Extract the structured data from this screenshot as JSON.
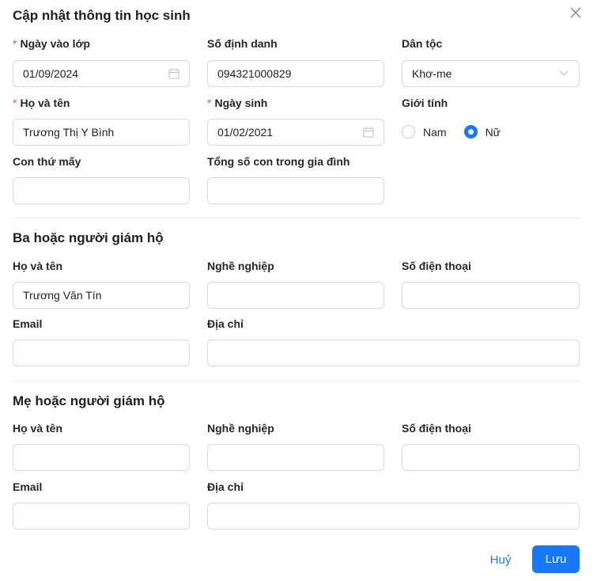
{
  "modal": {
    "title": "Cập nhật thông tin học sinh",
    "close_icon": "close-icon"
  },
  "student": {
    "enrollment_date": {
      "label": "Ngày vào lớp",
      "required": true,
      "value": "01/09/2024",
      "icon": "calendar-icon"
    },
    "id_number": {
      "label": "Số định danh",
      "value": "094321000829"
    },
    "ethnicity": {
      "label": "Dân tộc",
      "value": "Khơ-me",
      "icon": "chevron-down-icon"
    },
    "full_name": {
      "label": "Họ và tên",
      "required": true,
      "value": "Trương Thị Y Bình"
    },
    "birth_date": {
      "label": "Ngày sinh",
      "required": true,
      "value": "01/02/2021",
      "icon": "calendar-icon"
    },
    "gender": {
      "label": "Giới tính",
      "options": [
        "Nam",
        "Nữ"
      ],
      "selected": "Nữ"
    },
    "child_order": {
      "label": "Con thứ mấy",
      "value": ""
    },
    "total_children": {
      "label": "Tổng số con trong gia đình",
      "value": ""
    }
  },
  "father": {
    "section_title": "Ba hoặc người giám hộ",
    "full_name": {
      "label": "Họ và tên",
      "value": "Trương Văn Tín"
    },
    "occupation": {
      "label": "Nghề nghiệp",
      "value": ""
    },
    "phone": {
      "label": "Số điện thoại",
      "value": ""
    },
    "email": {
      "label": "Email",
      "value": ""
    },
    "address": {
      "label": "Địa chỉ",
      "value": ""
    }
  },
  "mother": {
    "section_title": "Mẹ hoặc người giám hộ",
    "full_name": {
      "label": "Họ và tên",
      "value": ""
    },
    "occupation": {
      "label": "Nghề nghiệp",
      "value": ""
    },
    "phone": {
      "label": "Số điện thoại",
      "value": ""
    },
    "email": {
      "label": "Email",
      "value": ""
    },
    "address": {
      "label": "Địa chỉ",
      "value": ""
    }
  },
  "footer": {
    "cancel_label": "Huỷ",
    "save_label": "Lưu"
  },
  "colors": {
    "primary": "#1677ff",
    "required": "#ff4d4f",
    "border": "#d9d9d9"
  }
}
